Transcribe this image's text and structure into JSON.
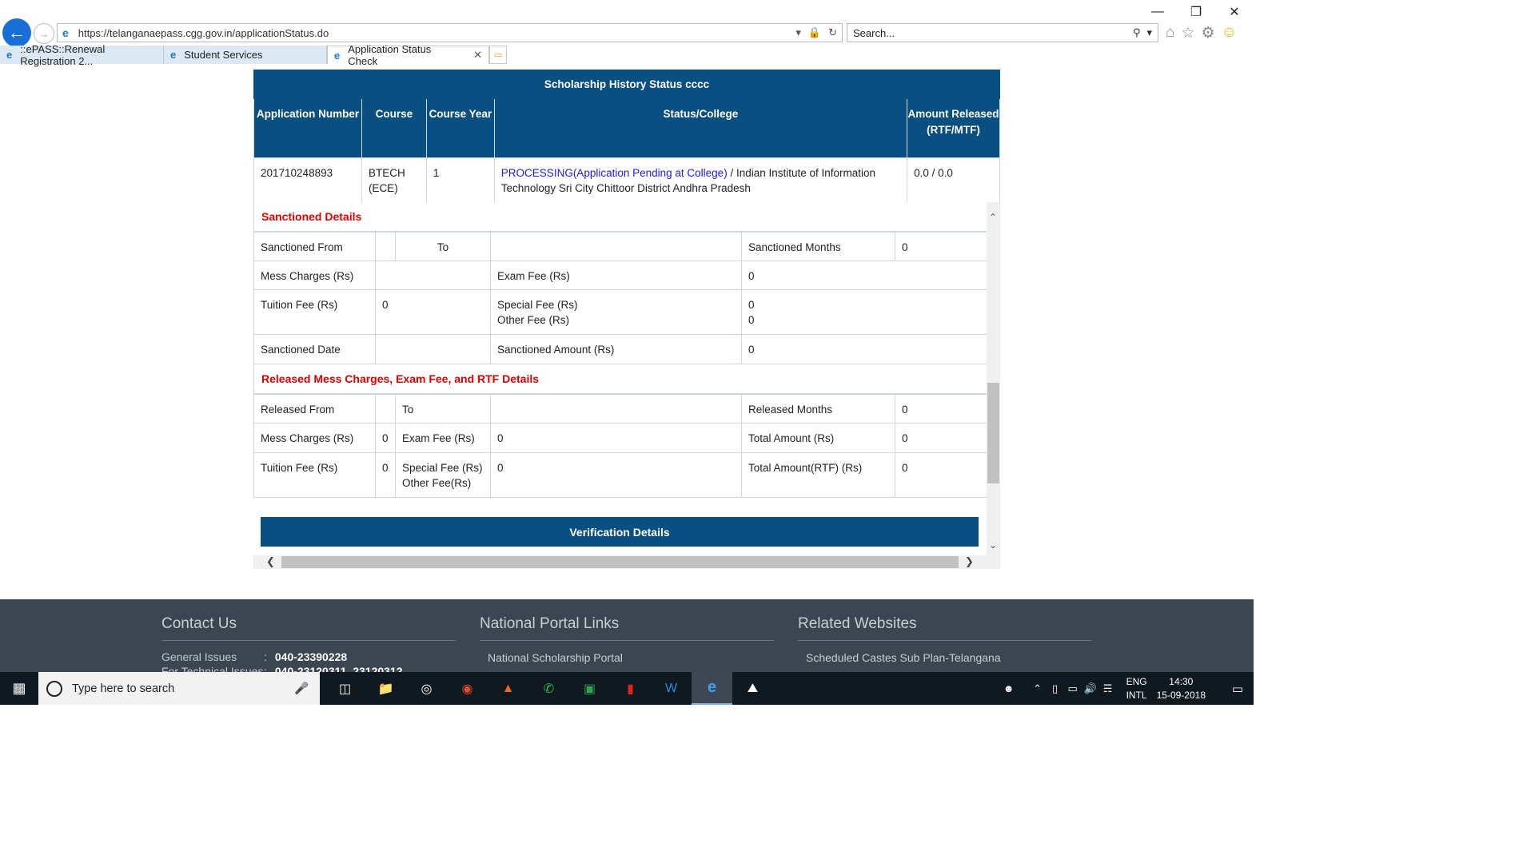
{
  "browser": {
    "url": "https://telanganaepass.cgg.gov.in/applicationStatus.do",
    "search_placeholder": "Search...",
    "tabs": [
      {
        "label": "::ePASS::Renewal Registration 2..."
      },
      {
        "label": "Student Services"
      },
      {
        "label": "Application Status Check"
      }
    ]
  },
  "history": {
    "title": "Scholarship History Status cccc",
    "headers": [
      "Application Number",
      "Course",
      "Course Year",
      "Status/College",
      "Amount Released (RTF/MTF)"
    ],
    "row": {
      "app_number": "201710248893",
      "course": "BTECH (ECE)",
      "year": "1",
      "status_link": "PROCESSING(Application Pending at College)",
      "college": " / Indian Institute of Information Technology Sri City Chittoor District Andhra Pradesh",
      "amount": "0.0 / 0.0"
    }
  },
  "sanctioned": {
    "title": "Sanctioned Details",
    "from_label": "Sanctioned From",
    "to_label": "To",
    "months_label": "Sanctioned Months",
    "months_value": "0",
    "mess_label": "Mess Charges (Rs)",
    "exam_label": "Exam Fee (Rs)",
    "exam_value": "0",
    "tuition_label": "Tuition Fee (Rs)",
    "tuition_value": "0",
    "special_label": "Special Fee (Rs)",
    "special_value": "0",
    "other_label": "Other Fee (Rs)",
    "other_value": "0",
    "date_label": "Sanctioned Date",
    "amount_label": "Sanctioned Amount (Rs)",
    "amount_value": "0"
  },
  "released": {
    "title": "Released Mess Charges, Exam Fee, and RTF Details",
    "from_label": "Released From",
    "to_label": "To",
    "months_label": "Released Months",
    "months_value": "0",
    "mess_label": "Mess Charges (Rs)",
    "mess_value": "0",
    "exam_label": "Exam Fee (Rs)",
    "exam_value": "0",
    "total_label": "Total Amount (Rs)",
    "total_value": "0",
    "tuition_label": "Tuition Fee (Rs)",
    "tuition_value": "0",
    "special_label": "Special Fee (Rs)",
    "other_label": "Other Fee(Rs)",
    "special_value": "0",
    "total_rtf_label": "Total Amount(RTF) (Rs)",
    "total_rtf_value": "0"
  },
  "verification": {
    "title": "Verification Details"
  },
  "footer": {
    "contact": {
      "title": "Contact Us",
      "general_label": "General Issues",
      "general_value": "040-23390228",
      "technical_label": "For Technical Issues",
      "technical_value": "040-23120311, 23120312"
    },
    "national": {
      "title": "National Portal Links",
      "item": "National Scholarship Portal"
    },
    "related": {
      "title": "Related Websites",
      "item": "Scheduled Castes Sub Plan-Telangana"
    }
  },
  "taskbar": {
    "search_placeholder": "Type here to search",
    "lang_top": "ENG",
    "lang_bottom": "INTL",
    "time": "14:30",
    "date": "15-09-2018"
  }
}
